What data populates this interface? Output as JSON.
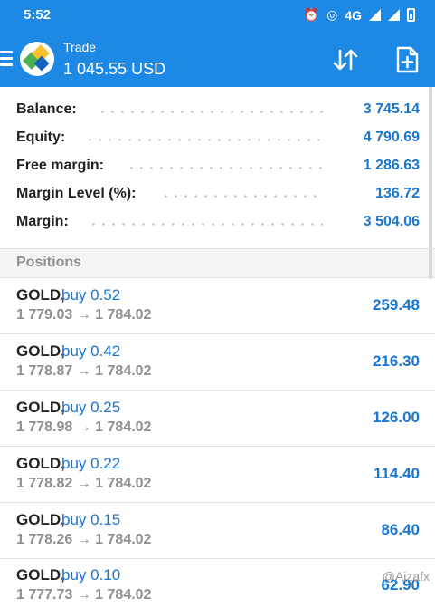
{
  "status": {
    "time": "5:52",
    "network": "4G"
  },
  "header": {
    "title": "Trade",
    "balance": "1 045.55 USD"
  },
  "summary": [
    {
      "label": "Balance:",
      "value": "3 745.14"
    },
    {
      "label": "Equity:",
      "value": "4 790.69"
    },
    {
      "label": "Free margin:",
      "value": "1 286.63"
    },
    {
      "label": "Margin Level (%):",
      "value": "136.72"
    },
    {
      "label": "Margin:",
      "value": "3 504.06"
    }
  ],
  "positions_title": "Positions",
  "positions": [
    {
      "symbol": "GOLD,",
      "side": "buy 0.52",
      "prices": "1 779.03 → 1 784.02",
      "profit": "259.48"
    },
    {
      "symbol": "GOLD,",
      "side": "buy 0.42",
      "prices": "1 778.87 → 1 784.02",
      "profit": "216.30"
    },
    {
      "symbol": "GOLD,",
      "side": "buy 0.25",
      "prices": "1 778.98 → 1 784.02",
      "profit": "126.00"
    },
    {
      "symbol": "GOLD,",
      "side": "buy 0.22",
      "prices": "1 778.82 → 1 784.02",
      "profit": "114.40"
    },
    {
      "symbol": "GOLD,",
      "side": "buy 0.15",
      "prices": "1 778.26 → 1 784.02",
      "profit": "86.40"
    },
    {
      "symbol": "GOLD,",
      "side": "buy 0.10",
      "prices": "1 777.73 → 1 784.02",
      "profit": "62.90"
    }
  ],
  "watermark": "@Aizafx",
  "colors": {
    "header_bg": "#1e88e5",
    "accent": "#1976d2",
    "muted": "#8f8f8f"
  },
  "icons": [
    "menu-icon",
    "app-logo-icon",
    "sort-icon",
    "new-order-icon",
    "alarm-icon",
    "data-saver-icon",
    "signal-icon",
    "battery-icon"
  ]
}
